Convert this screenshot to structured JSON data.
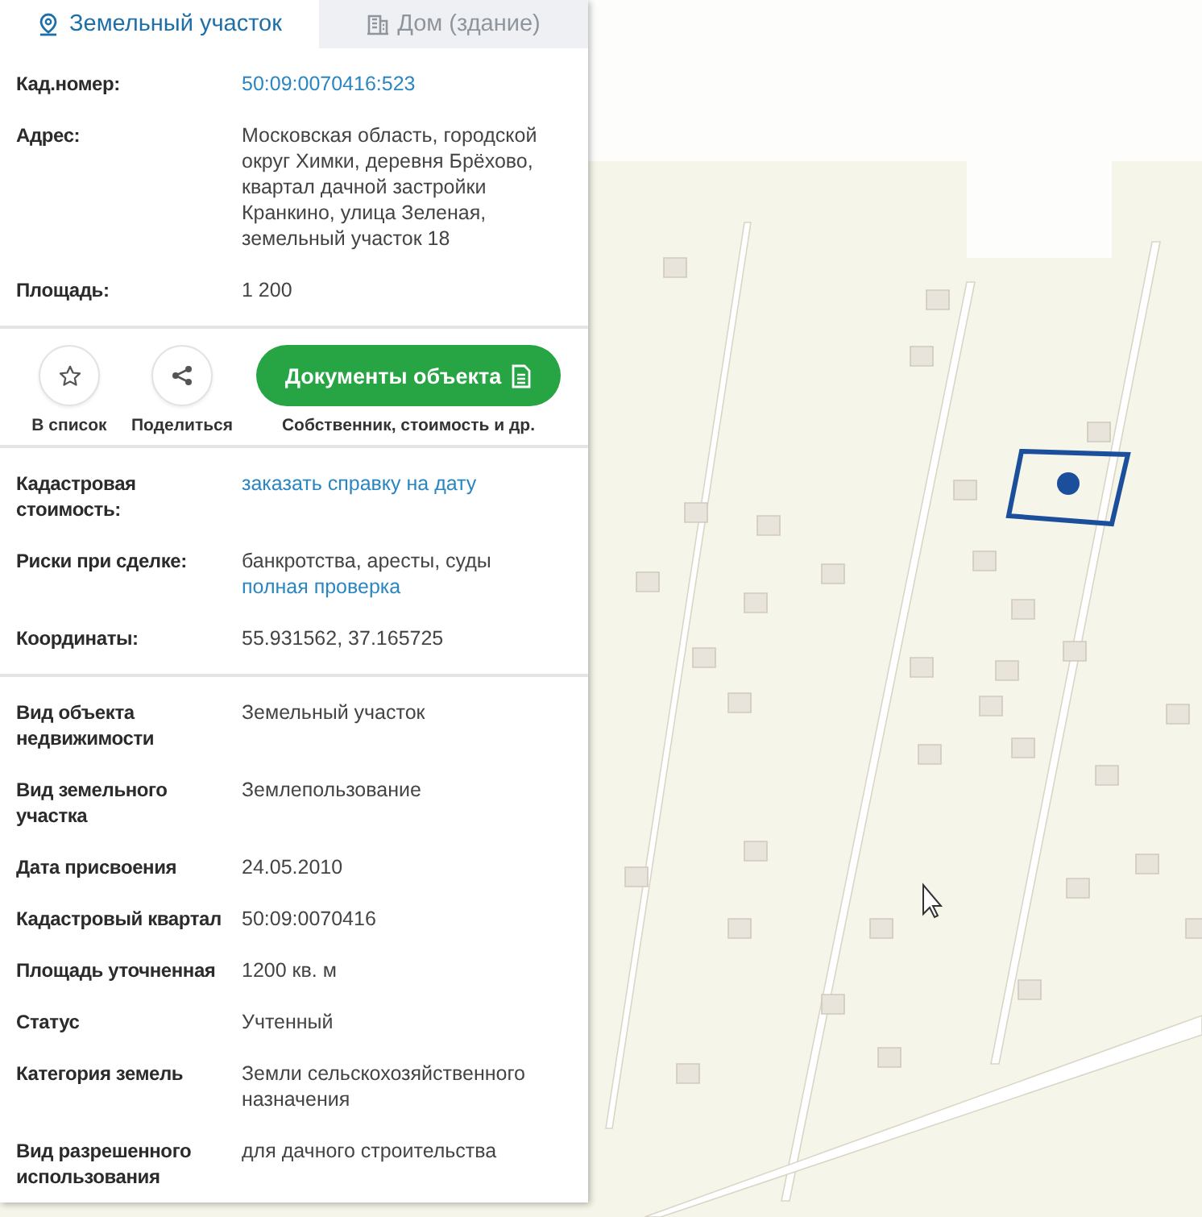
{
  "tabs": [
    {
      "label": "Земельный участок",
      "selected": true,
      "kind": "pin"
    },
    {
      "label": "Дом (здание)",
      "selected": false,
      "kind": "building"
    }
  ],
  "main_fields": [
    {
      "label": "Кад.номер:",
      "value": [
        {
          "text": "50:09:0070416:523",
          "kind": "link"
        }
      ]
    },
    {
      "label": "Адрес:",
      "value": [
        {
          "text": "Московская область, городской округ Химки, деревня Брёхово, квартал дачной застройки Кранкино, улица Зеленая, земельный участок 18",
          "kind": "text"
        }
      ]
    },
    {
      "label": "Площадь:",
      "value": [
        {
          "text": "1 200",
          "kind": "text"
        }
      ]
    }
  ],
  "actions": {
    "round_buttons": [
      {
        "label": "В список",
        "kind": "star"
      },
      {
        "label": "Поделиться",
        "kind": "share"
      }
    ],
    "documents_button": {
      "label": "Документы объекта",
      "caption": "Собственник, стоимость и др."
    }
  },
  "extra_fields": [
    {
      "label": "Кадастровая стоимость:",
      "value": [
        {
          "text": "заказать справку на дату",
          "kind": "link"
        }
      ]
    },
    {
      "label": "Риски при сделке:",
      "value": [
        {
          "text": "банкротства, аресты, суды",
          "kind": "text"
        },
        {
          "text": "полная проверка",
          "kind": "link"
        }
      ]
    },
    {
      "label": "Координаты:",
      "value": [
        {
          "text": "55.931562, 37.165725",
          "kind": "text"
        }
      ]
    }
  ],
  "details": [
    {
      "label": "Вид объекта недвижимости",
      "value": [
        {
          "text": "Земельный участок",
          "kind": "text"
        }
      ]
    },
    {
      "label": "Вид земельного участка",
      "value": [
        {
          "text": "Землепользование",
          "kind": "text"
        }
      ]
    },
    {
      "label": "Дата присвоения",
      "value": [
        {
          "text": "24.05.2010",
          "kind": "text"
        }
      ]
    },
    {
      "label": "Кадастровый квартал",
      "value": [
        {
          "text": "50:09:0070416",
          "kind": "text"
        }
      ]
    },
    {
      "label": "Площадь уточненная",
      "value": [
        {
          "text": "1200 кв. м",
          "kind": "text"
        }
      ]
    },
    {
      "label": "Статус",
      "value": [
        {
          "text": "Учтенный",
          "kind": "text"
        }
      ]
    },
    {
      "label": "Категория земель",
      "value": [
        {
          "text": "Земли сельскохозяйственного назначения",
          "kind": "text"
        }
      ]
    },
    {
      "label": "Вид разрешенного использования",
      "value": [
        {
          "text": "для дачного строительства",
          "kind": "text"
        }
      ]
    }
  ]
}
